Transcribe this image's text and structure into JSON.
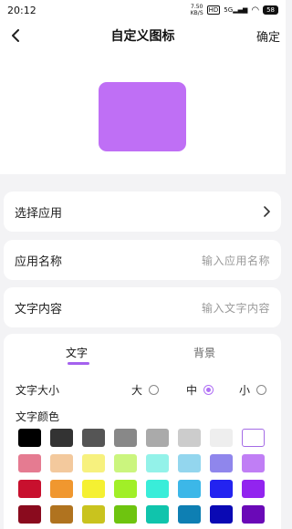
{
  "status_bar": {
    "time": "20:12",
    "net_speed_value": "7.50",
    "net_speed_unit": "KB/S",
    "hd_label": "HD",
    "signal_label": "5G",
    "battery": "58"
  },
  "header": {
    "title": "自定义图标",
    "confirm_label": "确定",
    "back_icon": "chevron-left-icon"
  },
  "preview": {
    "icon_color": "#bf6ff5"
  },
  "rows": {
    "select_app": {
      "label": "选择应用",
      "icon": "chevron-right-icon"
    },
    "app_name": {
      "label": "应用名称",
      "placeholder": "输入应用名称"
    },
    "text_content": {
      "label": "文字内容",
      "placeholder": "输入文字内容"
    }
  },
  "tabs": {
    "text": "文字",
    "background": "背景",
    "active": "text",
    "accent": "#a461ee"
  },
  "text_size": {
    "label": "文字大小",
    "options": [
      "大",
      "中",
      "小"
    ],
    "selected": "中"
  },
  "text_color": {
    "label": "文字颜色",
    "selected_color": "#ffffff",
    "swatches": [
      [
        "#000000",
        "#333333",
        "#555555",
        "#888888",
        "#aaaaaa",
        "#cccccc",
        "#eeeeee",
        "#ffffff"
      ],
      [
        "#e57b91",
        "#f3c99d",
        "#f7f17e",
        "#cbf57e",
        "#93f2e9",
        "#93d6ee",
        "#8f86ec",
        "#c07ef5"
      ],
      [
        "#c8102e",
        "#f0972f",
        "#f5f032",
        "#a1ef27",
        "#39edd9",
        "#3cb7e8",
        "#2323f0",
        "#9224ef"
      ],
      [
        "#8a0b1e",
        "#b0731f",
        "#c9c31e",
        "#6ec40f",
        "#10c4ac",
        "#0e7fb3",
        "#0a09b4",
        "#6a09b7"
      ]
    ]
  }
}
